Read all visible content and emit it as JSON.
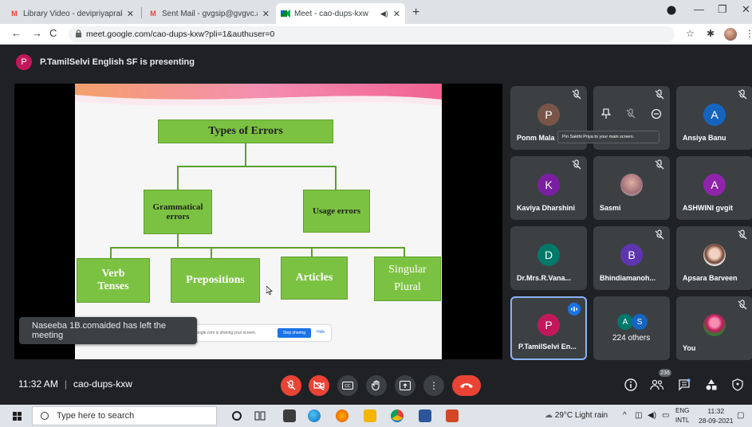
{
  "browser": {
    "tabs": [
      {
        "label": "Library Video - devipriyaprakash",
        "favicon": "gmail-icon"
      },
      {
        "label": "Sent Mail - gvgsip@gvgvc.ac.in",
        "favicon": "gmail-icon"
      },
      {
        "label": "Meet - cao-dups-kxw",
        "favicon": "meet-icon",
        "active": true
      }
    ],
    "url": "meet.google.com/cao-dups-kxw?pli=1&authuser=0"
  },
  "meeting": {
    "presenter_initial": "P",
    "presenting_text": "P.TamilSelvi English SF is presenting",
    "time": "11:32 AM",
    "code": "cao-dups-kxw",
    "participant_count": "236"
  },
  "slide": {
    "title": "Types of Errors",
    "grammatical": "Grammatical errors",
    "usage": "Usage errors",
    "verb": "Verb Tenses",
    "prepositions": "Prepositions",
    "articles": "Articles",
    "singular": "Singular Plural",
    "share_msg": "meet.google.com is sharing your screen.",
    "stop_sharing": "Stop sharing",
    "hide": "Hide"
  },
  "toast": "Naseeba 1B.comaided has left the meeting",
  "tooltip": "Pin Sakthi Priya to your main screen.",
  "tiles": [
    {
      "name": "Ponm Mala",
      "initial": "P",
      "color": "#795548"
    },
    {
      "name": "",
      "initial": "",
      "color": ""
    },
    {
      "name": "Ansiya Banu",
      "initial": "A",
      "color": "#1565c0"
    },
    {
      "name": "Kaviya Dharshini",
      "initial": "K",
      "color": "#7b1fa2"
    },
    {
      "name": "Sasmi",
      "initial": "",
      "color": ""
    },
    {
      "name": "ASHWINI gvgit",
      "initial": "A",
      "color": "#8e24aa"
    },
    {
      "name": "Dr.Mrs.R.Vana...",
      "initial": "D",
      "color": "#00796b"
    },
    {
      "name": "Bhindiamanoh...",
      "initial": "B",
      "color": "#5e35b1"
    },
    {
      "name": "Apsara Barveen",
      "initial": "",
      "color": ""
    },
    {
      "name": "P.TamilSelvi En...",
      "initial": "P",
      "color": "#c2185b"
    },
    {
      "name": "224 others",
      "initial": "",
      "color": ""
    },
    {
      "name": "You",
      "initial": "",
      "color": ""
    }
  ],
  "others": {
    "a": "A",
    "s": "S",
    "a_color": "#00796b",
    "s_color": "#1565c0"
  },
  "taskbar": {
    "search_placeholder": "Type here to search",
    "weather": "29°C  Light rain",
    "lang1": "ENG",
    "lang2": "INTL",
    "time": "11:32",
    "date": "28-09-2021"
  }
}
